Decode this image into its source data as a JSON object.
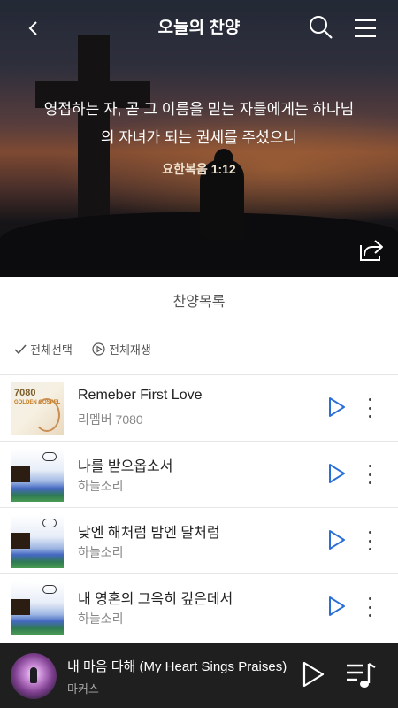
{
  "header": {
    "title": "오늘의 찬양"
  },
  "hero": {
    "verse_line1": "영접하는 자, 곧 그 이름을 믿는 자들에게는 하나님",
    "verse_line2": "의 자녀가 되는 권세를 주셨으니",
    "reference": "요한복음 1:12"
  },
  "list": {
    "title": "찬양목록",
    "select_all_label": "전체선택",
    "play_all_label": "전체재생"
  },
  "songs": [
    {
      "title": "Remeber First Love",
      "artist": "리멤버 7080",
      "art": "golden-gospel-album-art",
      "art_text_1": "7080",
      "art_text_2": "GOLDEN GOSPEL"
    },
    {
      "title": "나를 받으옵소서",
      "artist": "하늘소리",
      "art": "sky-album-art"
    },
    {
      "title": "낮엔 해처럼 밤엔 달처럼",
      "artist": "하늘소리",
      "art": "sky-album-art"
    },
    {
      "title": "내 영혼의 그윽히 깊은데서",
      "artist": "하늘소리",
      "art": "sky-album-art"
    }
  ],
  "now_playing": {
    "title": "내 마음 다해 (My Heart Sings Praises)",
    "artist": "마커스"
  },
  "colors": {
    "accent": "#2a6fd6",
    "player_bg": "#1f1f1f"
  }
}
